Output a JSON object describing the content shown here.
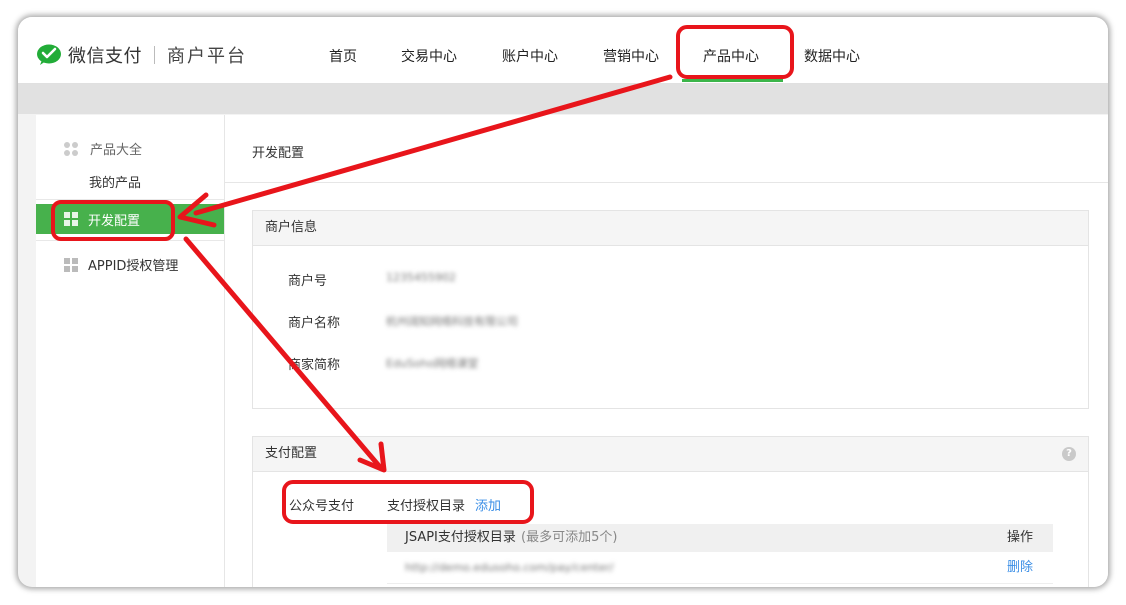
{
  "header": {
    "logo_text": "微信支付",
    "logo_sub": "商户平台",
    "nav": [
      {
        "label": "首页"
      },
      {
        "label": "交易中心"
      },
      {
        "label": "账户中心"
      },
      {
        "label": "营销中心"
      },
      {
        "label": "产品中心"
      },
      {
        "label": "数据中心"
      }
    ],
    "accent_color": "#3bb54a"
  },
  "sidebar": {
    "group_label": "产品大全",
    "my_products": "我的产品",
    "active_item": "开发配置",
    "appid_item": "APPID授权管理"
  },
  "main": {
    "title": "开发配置",
    "merchant_panel": {
      "title": "商户信息",
      "rows": [
        {
          "label": "商户号",
          "value": "1235455902"
        },
        {
          "label": "商户名称",
          "value": "杭州阔知网络科技有限公司"
        },
        {
          "label": "商家简称",
          "value": "EduSoho网络课堂"
        }
      ]
    },
    "payment_panel": {
      "title": "支付配置",
      "help_icon": "?",
      "method_label": "公众号支付",
      "dir_label": "支付授权目录",
      "add_link": "添加",
      "table": {
        "col_dir": "JSAPI支付授权目录",
        "col_dir_note": "(最多可添加5个)",
        "col_ops": "操作",
        "rows": [
          {
            "url": "http://demo.edusoho.com/pay/center/",
            "action": "删除"
          }
        ]
      }
    }
  },
  "annotations": {
    "color": "#e8151b"
  }
}
